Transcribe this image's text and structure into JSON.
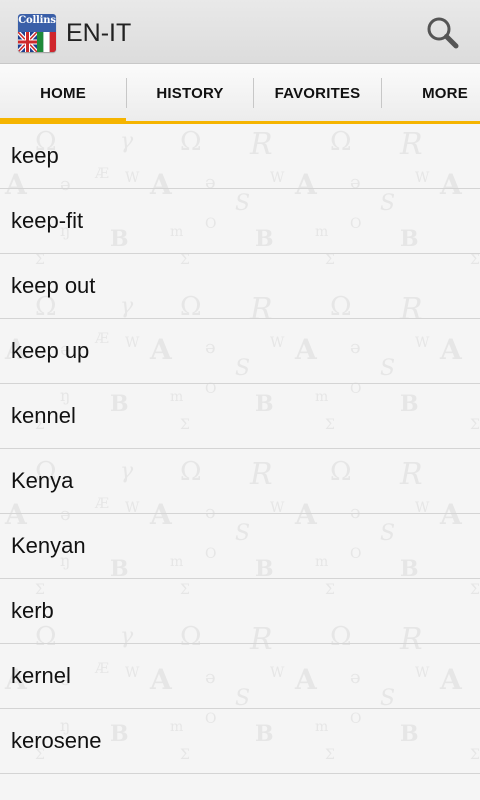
{
  "app_bar": {
    "logo_text": "Collins",
    "title": "EN-IT",
    "search_icon": "search-icon"
  },
  "tabs": [
    {
      "label": "HOME",
      "selected": true
    },
    {
      "label": "HISTORY",
      "selected": false
    },
    {
      "label": "FAVORITES",
      "selected": false
    },
    {
      "label": "MORE",
      "selected": false
    }
  ],
  "words": [
    "keep",
    "keep-fit",
    "keep out",
    "keep up",
    "kennel",
    "Kenya",
    "Kenyan",
    "kerb",
    "kernel",
    "kerosene"
  ],
  "colors": {
    "accent": "#f5b400",
    "logo_blue": "#3a5fa8",
    "text": "#111111"
  }
}
